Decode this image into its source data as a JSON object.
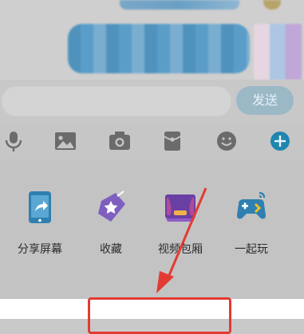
{
  "input": {
    "placeholder": "",
    "send_label": "发送"
  },
  "toolbar": {
    "icons": [
      "microphone-icon",
      "image-icon",
      "camera-icon",
      "red-packet-icon",
      "emoji-icon",
      "plus-icon"
    ],
    "accent": "#1fa3e3"
  },
  "panel": {
    "items": [
      {
        "label": "分享屏幕",
        "icon": "share-screen-icon"
      },
      {
        "label": "收藏",
        "icon": "favorites-icon"
      },
      {
        "label": "视频包厢",
        "icon": "video-booth-icon"
      },
      {
        "label": "一起玩",
        "icon": "play-together-icon"
      }
    ]
  },
  "annotation": {
    "arrow_color": "#e33a32",
    "highlight_text": ""
  }
}
